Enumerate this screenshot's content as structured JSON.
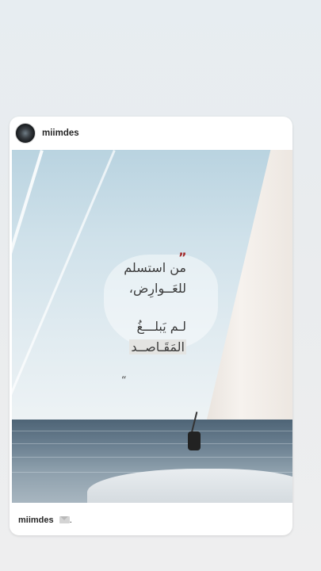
{
  "post": {
    "username": "miimdes",
    "quote": {
      "open_mark": "”",
      "line1": "من استسلم",
      "line2": "للعَــوارِض،",
      "line3": "لـم يَبلـــغُ",
      "line4": "المَقَـاصــد",
      "close_mark": "“"
    },
    "caption": {
      "username": "miimdes",
      "suffix": "."
    }
  },
  "icons": {
    "avatar": "profile-avatar",
    "caption_icon": "envelope-icon"
  },
  "colors": {
    "quote_mark": "#a32a2a",
    "text": "#262626"
  }
}
